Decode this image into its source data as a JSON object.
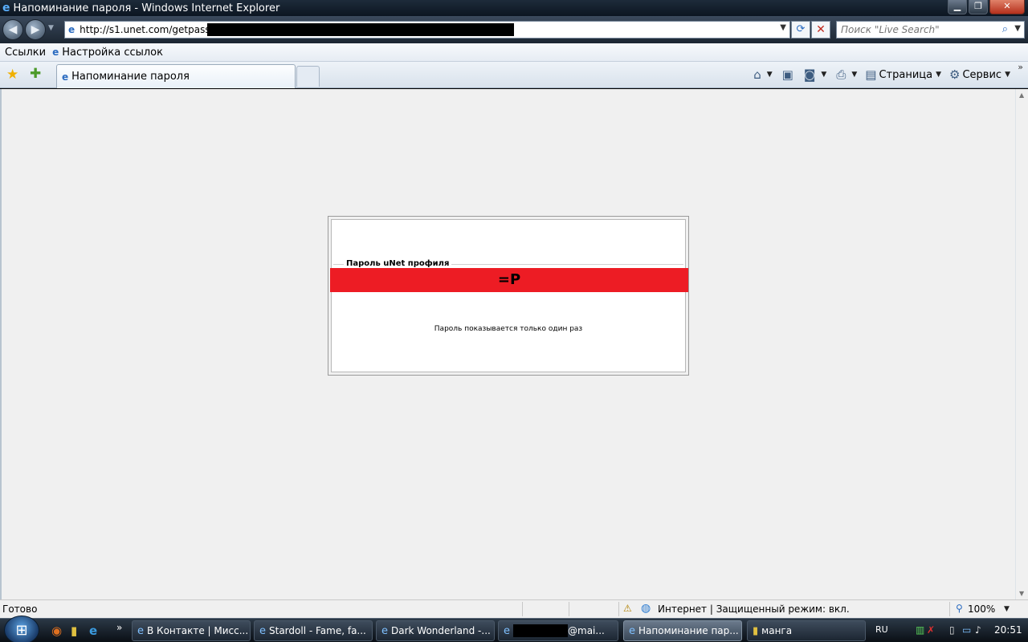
{
  "window": {
    "title": "Напоминание пароля - Windows Internet Explorer",
    "minimize": "▁",
    "maximize": "❐",
    "close": "✕"
  },
  "address_bar": {
    "url": "http://s1.unet.com/getpass/",
    "search_placeholder": "Поиск \"Live Search\""
  },
  "links_bar": {
    "items": [
      "Ссылки",
      "Настройка ссылок"
    ]
  },
  "tab": {
    "title": "Напоминание пароля"
  },
  "command_bar": {
    "page_label": "Страница",
    "tools_label": "Сервис"
  },
  "page": {
    "legend": "Пароль uNet профиля",
    "password": "=P",
    "note": "Пароль показывается только один раз",
    "colors": {
      "password_bar": "#ed1c24",
      "background": "#f0f0f0"
    }
  },
  "status_bar": {
    "ready": "Готово",
    "zone": "Интернет | Защищенный режим: вкл.",
    "zoom": "100%"
  },
  "taskbar": {
    "tasks": [
      "В Контакте | Мисс...",
      "Stardoll - Fame, fa...",
      "Dark Wonderland -...",
      "@mai...",
      "Напоминание пар...",
      "манга"
    ],
    "language": "RU",
    "clock": "20:51"
  }
}
